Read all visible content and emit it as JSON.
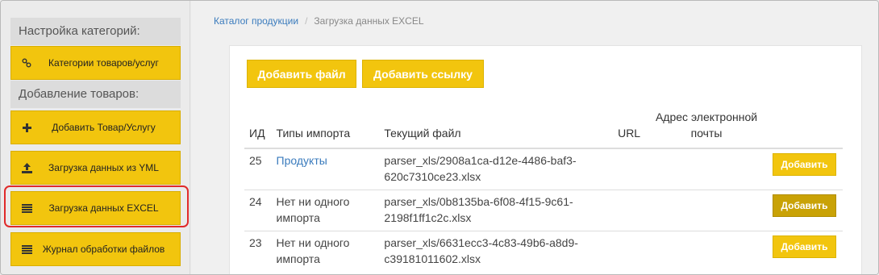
{
  "sidebar": {
    "section_categories": "Настройка категорий:",
    "btn_categories": "Категории товаров/услуг",
    "section_add": "Добавление товаров:",
    "btn_add_product": "Добавить Товар/Услугу",
    "btn_yml": "Загрузка данных из YML",
    "btn_excel": "Загрузка данных EXCEL",
    "btn_journal": "Журнал обработки файлов"
  },
  "breadcrumb": {
    "catalog": "Каталог продукции",
    "separator": "/",
    "current": "Загрузка данных EXCEL"
  },
  "toolbar": {
    "add_file": "Добавить файл",
    "add_link": "Добавить ссылку"
  },
  "table": {
    "headers": {
      "id": "ИД",
      "types": "Типы импорта",
      "file": "Текущий файл",
      "url": "URL",
      "email_1": "Адрес электронной",
      "email_2": "почты"
    },
    "rows": [
      {
        "id": "25",
        "type": "Продукты",
        "file_1": "parser_xls/2908a1ca-d12e-4486-baf3-",
        "file_2": "620c7310ce23.xlsx",
        "action": "Добавить"
      },
      {
        "id": "24",
        "type_1": "Нет ни одного",
        "type_2": "импорта",
        "file_1": "parser_xls/0b8135ba-6f08-4f15-9c61-",
        "file_2": "2198f1ff1c2c.xlsx",
        "action": "Добавить"
      },
      {
        "id": "23",
        "type_1": "Нет ни одного",
        "type_2": "импорта",
        "file_1": "parser_xls/6631ecc3-4c83-49b6-a8d9-",
        "file_2": "c39181011602.xlsx",
        "action": "Добавить"
      }
    ]
  },
  "colors": {
    "accent": "#f2c50e",
    "link": "#3a7bbd",
    "highlight": "#e02a2a"
  }
}
